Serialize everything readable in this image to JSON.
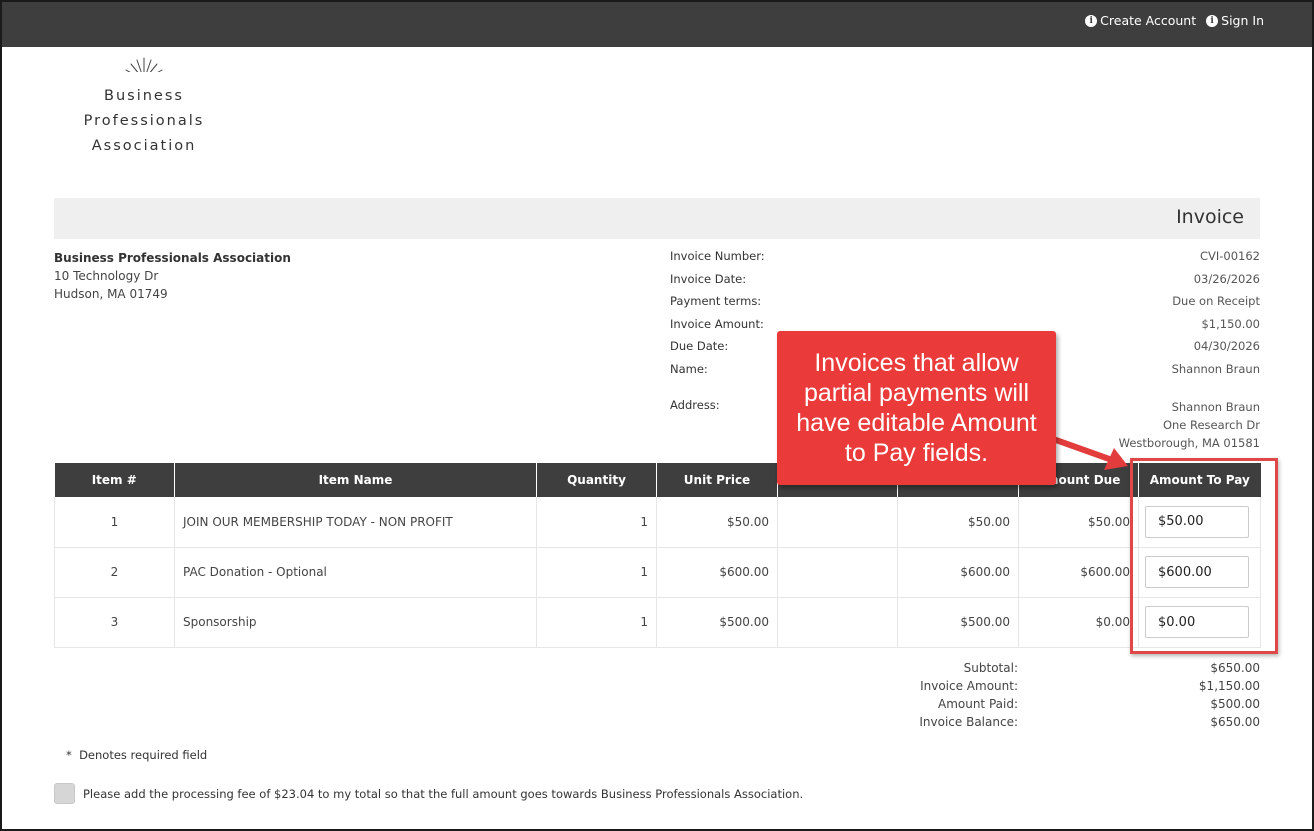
{
  "topbar": {
    "create_account": "Create Account",
    "sign_in": "Sign In"
  },
  "logo": {
    "line1": "Business",
    "line2": "Professionals",
    "line3": "Association"
  },
  "invoice_title": "Invoice",
  "org": {
    "name": "Business Professionals Association",
    "street": "10 Technology Dr",
    "city": "Hudson, MA 01749"
  },
  "meta": {
    "invoice_number_label": "Invoice Number:",
    "invoice_number": "CVI-00162",
    "invoice_date_label": "Invoice Date:",
    "invoice_date": "03/26/2026",
    "payment_terms_label": "Payment terms:",
    "payment_terms": "Due on Receipt",
    "invoice_amount_label": "Invoice Amount:",
    "invoice_amount": "$1,150.00",
    "due_date_label": "Due Date:",
    "due_date": "04/30/2026",
    "name_label": "Name:",
    "name": "Shannon Braun",
    "address_label": "Address:",
    "address_line1": "Shannon Braun",
    "address_line2": "One Research Dr",
    "address_line3": "Westborough, MA 01581"
  },
  "table": {
    "headers": [
      "Item #",
      "Item Name",
      "Quantity",
      "Unit Price",
      "",
      "",
      "Amount Due",
      "Amount To Pay"
    ],
    "rows": [
      {
        "num": "1",
        "name": "JOIN OUR MEMBERSHIP TODAY - NON PROFIT",
        "qty": "1",
        "unit": "$50.00",
        "col5": "",
        "col6": "$50.00",
        "due": "$50.00",
        "pay": "$50.00"
      },
      {
        "num": "2",
        "name": "PAC Donation - Optional",
        "qty": "1",
        "unit": "$600.00",
        "col5": "",
        "col6": "$600.00",
        "due": "$600.00",
        "pay": "$600.00"
      },
      {
        "num": "3",
        "name": "Sponsorship",
        "qty": "1",
        "unit": "$500.00",
        "col5": "",
        "col6": "$500.00",
        "due": "$0.00",
        "pay": "$0.00"
      }
    ]
  },
  "totals": {
    "subtotal_label": "Subtotal:",
    "subtotal": "$650.00",
    "invoice_amount_label": "Invoice Amount:",
    "invoice_amount": "$1,150.00",
    "amount_paid_label": "Amount Paid:",
    "amount_paid": "$500.00",
    "balance_label": "Invoice Balance:",
    "balance": "$650.00"
  },
  "required_note": "Denotes required field",
  "required_mark": "*",
  "fee_text": "Please add the processing fee of $23.04 to my total so that the full amount goes towards Business Professionals Association.",
  "callout": "Invoices that allow partial payments will have editable Amount to Pay fields.",
  "colors": {
    "topbar": "#3e3e3e",
    "callout": "#ea3a3a",
    "highlight": "#e04848"
  }
}
